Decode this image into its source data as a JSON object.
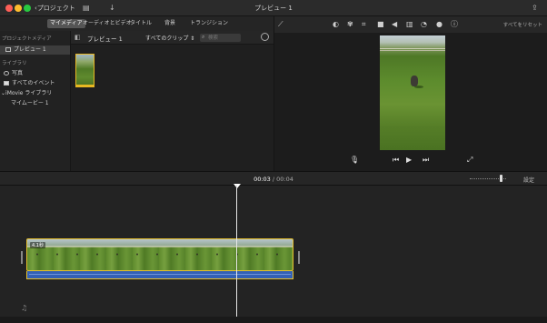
{
  "window": {
    "back_label": "プロジェクト",
    "title": "プレビュー 1"
  },
  "browser_tabs": [
    {
      "label": "マイメディア",
      "active": true
    },
    {
      "label": "オーディオとビデオ",
      "active": false
    },
    {
      "label": "タイトル",
      "active": false
    },
    {
      "label": "背景",
      "active": false
    },
    {
      "label": "トランジション",
      "active": false
    }
  ],
  "sidebar": {
    "project_media_header": "プロジェクトメディア",
    "project_item": "プレビュー 1",
    "library_header": "ライブラリ",
    "photos": "写真",
    "all_events": "すべてのイベント",
    "imovie_library": "iMovie ライブラリ",
    "my_movie": "マイムービー 1"
  },
  "browser": {
    "title": "プレビュー 1",
    "filter": "すべてのクリップ",
    "search_placeholder": "検索"
  },
  "viewer": {
    "reset_all": "すべてをリセット",
    "tool_icons": [
      "color-balance-icon",
      "color-correction-icon",
      "crop-icon",
      "stabilization-icon",
      "volume-icon",
      "noise-eq-icon",
      "speed-icon",
      "clip-filter-icon",
      "info-icon"
    ]
  },
  "timeline": {
    "current_time": "00:03",
    "separator": "/",
    "total_time": "00:04",
    "settings_label": "設定",
    "clip_duration": "4.1秒",
    "zoom_level": 0.85
  },
  "colors": {
    "selection_yellow": "#e8c12c",
    "audio_blue": "#3360b5",
    "active_tab": "#555555"
  }
}
